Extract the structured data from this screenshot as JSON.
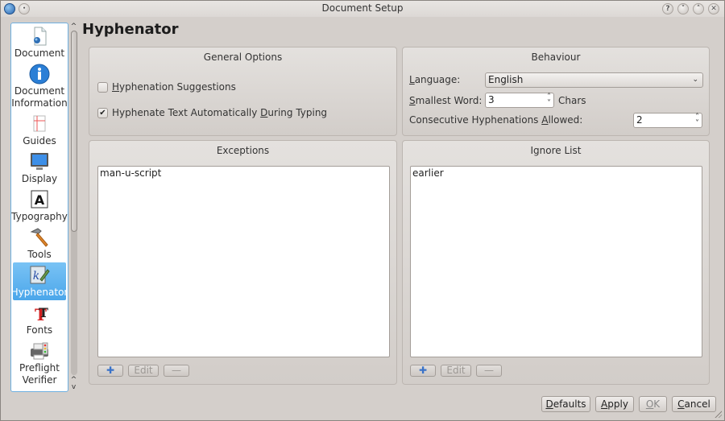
{
  "window": {
    "title": "Document Setup",
    "titlebar_buttons": [
      "help",
      "minimize",
      "maximize",
      "close"
    ]
  },
  "sidebar": {
    "items": [
      {
        "label": "Document",
        "icon": "document-icon",
        "active": false
      },
      {
        "label": "Document Information",
        "icon": "info-icon",
        "active": false
      },
      {
        "label": "Guides",
        "icon": "guides-icon",
        "active": false
      },
      {
        "label": "Display",
        "icon": "monitor-icon",
        "active": false
      },
      {
        "label": "Typography",
        "icon": "typography-icon",
        "active": false
      },
      {
        "label": "Tools",
        "icon": "hammer-icon",
        "active": false
      },
      {
        "label": "Hyphenator",
        "icon": "hyphenator-icon",
        "active": true
      },
      {
        "label": "Fonts",
        "icon": "fonts-icon",
        "active": false
      },
      {
        "label": "Preflight Verifier",
        "icon": "printer-icon",
        "active": false
      },
      {
        "label": "",
        "icon": "pdf-icon",
        "active": false
      }
    ],
    "scroll_up": "^",
    "scroll_down": "v"
  },
  "page": {
    "title": "Hyphenator"
  },
  "general_options": {
    "title": "General Options",
    "hyphenation_suggestions": {
      "label_mnemonic": "H",
      "label_rest": "yphenation Suggestions",
      "checked": false
    },
    "hyphenate_auto": {
      "label_before": "Hyphenate Text Automatically ",
      "label_mnemonic": "D",
      "label_after": "uring Typing",
      "checked": true,
      "check_glyph": "✔"
    }
  },
  "behaviour": {
    "title": "Behaviour",
    "language_label_mnemonic": "L",
    "language_label_rest": "anguage:",
    "language_value": "English",
    "smallest_word_label_mnemonic": "S",
    "smallest_word_label_rest": "mallest Word:",
    "smallest_word_value": "3",
    "smallest_word_suffix": "Chars",
    "consecutive_label_before": "Consecutive Hyphenations ",
    "consecutive_label_mnemonic": "A",
    "consecutive_label_after": "llowed:",
    "consecutive_value": "2"
  },
  "exceptions": {
    "title": "Exceptions",
    "items": [
      "man-u-script"
    ],
    "add_label": "✚",
    "edit_label": "Edit",
    "remove_label": "—"
  },
  "ignore_list": {
    "title": "Ignore List",
    "items": [
      "earlier"
    ],
    "add_label": "✚",
    "edit_label": "Edit",
    "remove_label": "—"
  },
  "footer": {
    "defaults_mnemonic": "D",
    "defaults_rest": "efaults",
    "apply_mnemonic": "A",
    "apply_rest": "pply",
    "ok_mnemonic": "O",
    "ok_rest": "K",
    "cancel_mnemonic": "C",
    "cancel_rest": "ancel"
  },
  "colors": {
    "accent": "#4ba6ea",
    "add_icon": "#3b73c8"
  }
}
